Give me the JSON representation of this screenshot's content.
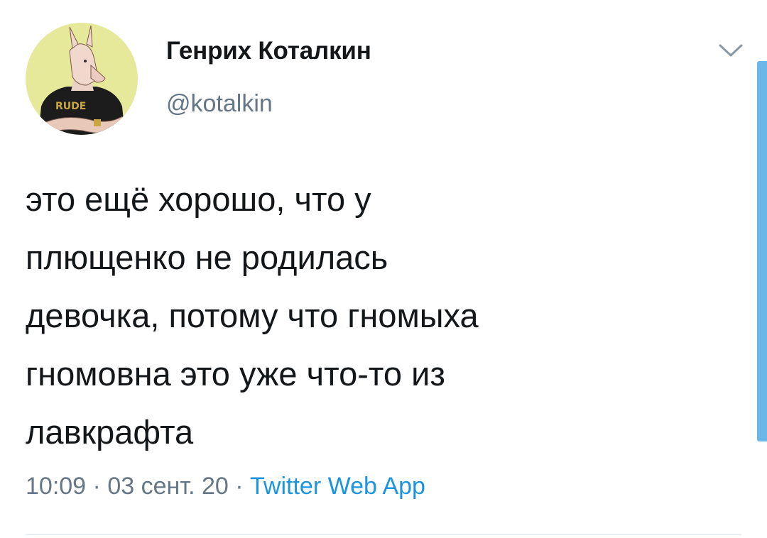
{
  "user": {
    "display_name": "Генрих Коталкин",
    "handle": "@kotalkin",
    "avatar_shirt_text": "RUDE"
  },
  "tweet": {
    "lines": [
      "это ещё хорошо, что у",
      "плющенко не родилась",
      "девочка, потому что гномыха",
      "гномовна это уже что-то из",
      "лавкрафта"
    ]
  },
  "meta": {
    "time": "10:09",
    "separator": "·",
    "date": "03 сент. 20",
    "source": "Twitter Web App"
  },
  "colors": {
    "text": "#14171a",
    "secondary": "#657786",
    "link": "#1b95e0",
    "scrollbar": "#6bb7e8",
    "avatar_bg": "#e6e89a"
  },
  "icons": {
    "menu": "chevron-down-icon"
  }
}
